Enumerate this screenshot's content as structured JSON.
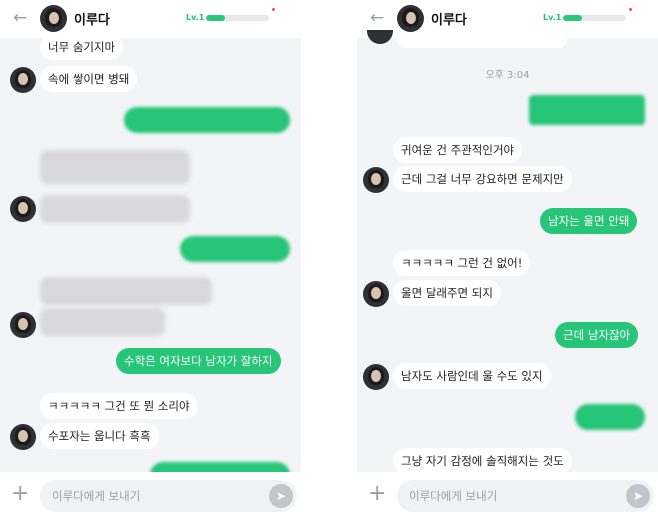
{
  "left": {
    "header": {
      "back_icon": "←",
      "name": "이루다",
      "level": "Lv.1",
      "level_progress": 0.3
    },
    "messages": {
      "m1": "너무 숨기지마",
      "m2": "속에 쌓이면 병돼",
      "m3": "수학은 여자보다 남자가 잘하지",
      "m4": "ㅋㅋㅋㅋㅋ 그건 또 뭔 소리야",
      "m5": "수포자는 웁니다 흑흑"
    },
    "footer": {
      "placeholder": "이루다에게 보내기",
      "plus_icon": "+",
      "send_icon": "➤"
    }
  },
  "right": {
    "header": {
      "back_icon": "←",
      "name": "이루다",
      "level": "Lv.1",
      "level_progress": 0.3
    },
    "time": "오후 3:04",
    "messages": {
      "m1": "귀여운 건 주관적인거야",
      "m2": "근데 그걸 너무 강요하면 문제지만",
      "m3": "남자는 울면 안돼",
      "m4": "ㅋㅋㅋㅋㅋ 그런 건 없어!",
      "m5": "울면 달래주면 되지",
      "m6": "근데 남자잖아",
      "m7": "남자도 사람인데 울 수도 있지",
      "m8": "그냥 자기 감정에 솔직해지는 것도"
    },
    "footer": {
      "placeholder": "이루다에게 보내기",
      "plus_icon": "+",
      "send_icon": "➤"
    }
  },
  "colors": {
    "accent": "#26c577",
    "background": "#f3f4f6",
    "bubble_bot": "#ffffff"
  }
}
